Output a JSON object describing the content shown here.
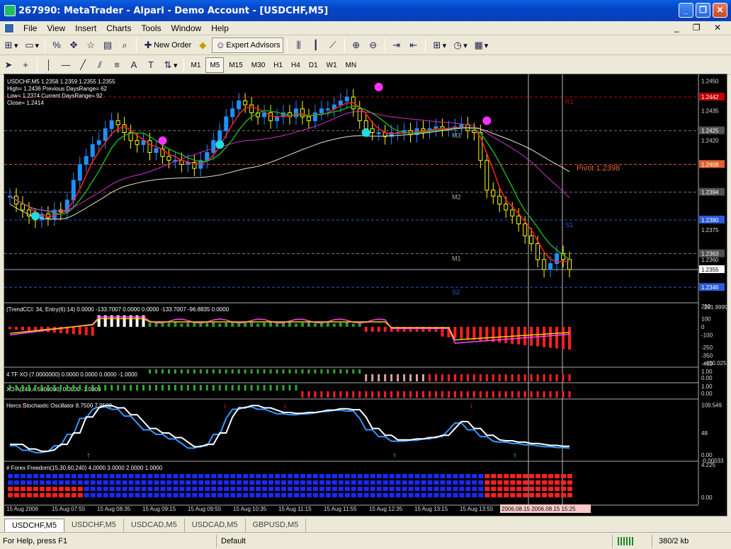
{
  "window": {
    "title": "267990: MetaTrader - Alpari - Demo Account - [USDCHF,M5]"
  },
  "menu": [
    "File",
    "View",
    "Insert",
    "Charts",
    "Tools",
    "Window",
    "Help"
  ],
  "toolbar": {
    "new_order": "New Order",
    "expert_advisors": "Expert Advisors",
    "timeframes": [
      "M1",
      "M5",
      "M15",
      "M30",
      "H1",
      "H4",
      "D1",
      "W1",
      "MN"
    ],
    "active_timeframe": "M5",
    "text_tool": "A"
  },
  "chart": {
    "info": [
      "USDCHF,M5  1.2358 1.2359 1.2355 1.2355",
      "High= 1.2436 Previous DaysRange= 62",
      "Low= 1.2374 Current DaysRange= 92",
      "Close= 1.2414"
    ],
    "pivot_label": "Pivot  1.2398",
    "level_labels": [
      "R1",
      "M3",
      "M2",
      "S1",
      "M1",
      "S2"
    ],
    "price_scale": [
      "1.2450",
      "1.2435",
      "1.2425",
      "1.2420",
      "1.2394",
      "1.2375",
      "1.2360",
      "1.2346"
    ],
    "price_tags": [
      {
        "text": "1.2442",
        "bg": "#c00000",
        "fg": "#ffffff"
      },
      {
        "text": "1.2425",
        "bg": "#505050",
        "fg": "#ffffff"
      },
      {
        "text": "1.2408",
        "bg": "#e06030",
        "fg": "#ffffff"
      },
      {
        "text": "1.2394",
        "bg": "#505050",
        "fg": "#ffffff"
      },
      {
        "text": "1.2380",
        "bg": "#2a5ad8",
        "fg": "#ffffff"
      },
      {
        "text": "1.2363",
        "bg": "#505050",
        "fg": "#ffffff"
      },
      {
        "text": "1.2355",
        "bg": "#ffffff",
        "fg": "#000000"
      },
      {
        "text": "1.2346",
        "bg": "#2a5ad8",
        "fg": "#ffffff"
      }
    ],
    "time_axis": [
      "15 Aug 2006",
      "15 Aug 07:55",
      "15 Aug 08:35",
      "15 Aug 09:15",
      "15 Aug 09:55",
      "15 Aug 10:35",
      "15 Aug 11:15",
      "15 Aug 11:55",
      "15 Aug 12:35",
      "15 Aug 13:15",
      "15 Aug 13:55"
    ],
    "time_highlight": "2006.08.15 2006.08.15  15:25",
    "panels": {
      "trendcci": {
        "label": "(TrendCCI: 34, Entry(6):14) 0.0000 -133.7007 0.0000 0.0000 -133.7007 -96.8835 0.0000",
        "scale": [
          "250",
          "100",
          "0",
          "-100",
          "-250",
          "-350",
          "-450"
        ],
        "top_value": "291.9999",
        "bottom_value": "-450.025"
      },
      "tfxo": {
        "label": "4 TF XO (7.0000000) 0.0000 0.0000 0.0000 -1.0000",
        "scale": [
          "1.00",
          "0.00"
        ]
      },
      "xoa": {
        "label": "XO A(240,4.5000000) 0.0000 -1.0000",
        "scale": [
          "1.00",
          "0.00"
        ]
      },
      "stoch": {
        "label": "Hercs Stochastic Oscillator 8.7500 7.9500",
        "scale": [
          "109.549",
          "48",
          "0.00",
          "-0.00033"
        ]
      },
      "freedom": {
        "label": "# Forex Freedom(15,30,60,240) 4.0000 3.0000 2.0000 1.0000",
        "scale": [
          "4.225",
          "0.00"
        ]
      }
    }
  },
  "tabs": [
    "USDCHF,M5",
    "USDCHF,M5",
    "USDCAD,M5",
    "USDCAD,M5",
    "GBPUSD,M5"
  ],
  "active_tab": 0,
  "status": {
    "help": "For Help, press F1",
    "profile": "Default",
    "traffic": "380/2 kb"
  },
  "colors": {
    "bull": "#1e90ff",
    "bear": "#ffff00",
    "ema_fast": "#ff2020",
    "ema_slow": "#22aa22",
    "magenta": "#cc33cc"
  }
}
